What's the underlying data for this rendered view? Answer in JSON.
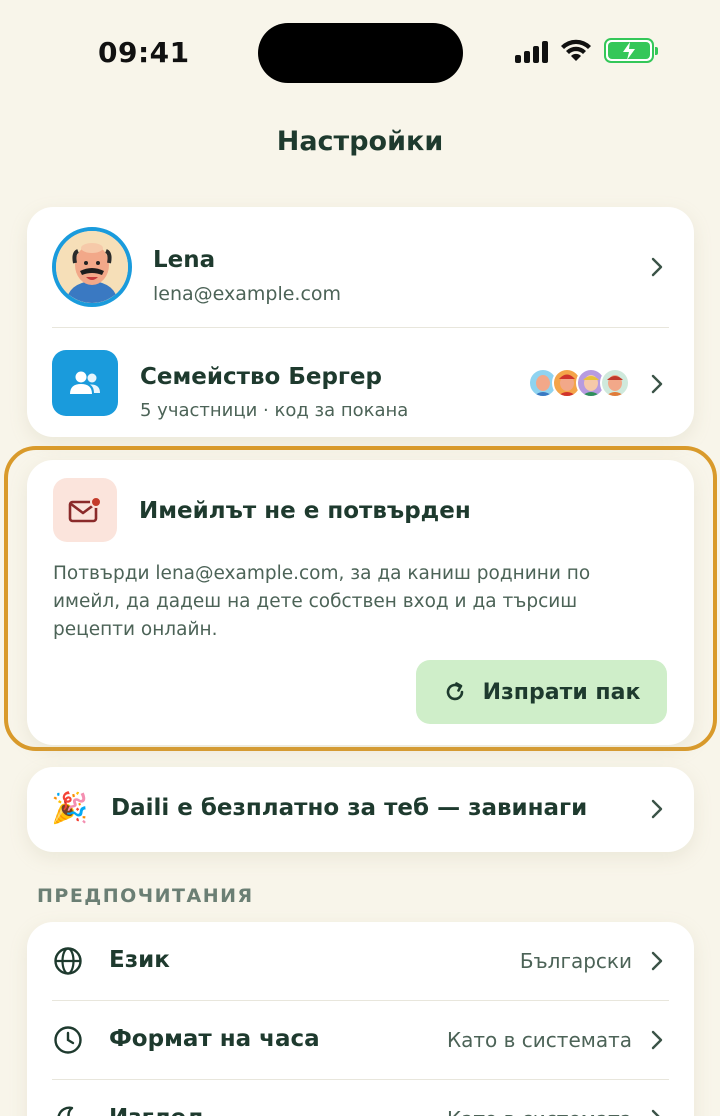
{
  "status_bar": {
    "time": "09:41"
  },
  "page": {
    "title": "Настройки"
  },
  "profile": {
    "name": "Lena",
    "email": "lena@example.com"
  },
  "family": {
    "name": "Семейство Бергер",
    "subtitle": "5 участници · код за покана"
  },
  "email_warning": {
    "title": "Имейлът не е потвърден",
    "body": "Потвърди lena@example.com, за да каниш роднини по имейл, да дадеш на дете собствен вход и да търсиш рецепти онлайн.",
    "resend_label": "Изпрати пак"
  },
  "free_banner": {
    "emoji": "🎉",
    "text": "Daili е безплатно за теб — завинаги"
  },
  "preferences": {
    "section_label": "ПРЕДПОЧИТАНИЯ",
    "items": [
      {
        "label": "Език",
        "value": "Български",
        "icon": "globe-icon"
      },
      {
        "label": "Формат на часа",
        "value": "Като в системата",
        "icon": "clock-icon"
      },
      {
        "label": "Изглед",
        "value": "Като в системата",
        "icon": "moon-icon"
      }
    ]
  },
  "colors": {
    "background": "#f8f5ea",
    "primary_text": "#1e3a2e",
    "accent_blue": "#1a9bdc",
    "warning_outline": "#d99a2b",
    "resend_button": "#cfeec9"
  }
}
